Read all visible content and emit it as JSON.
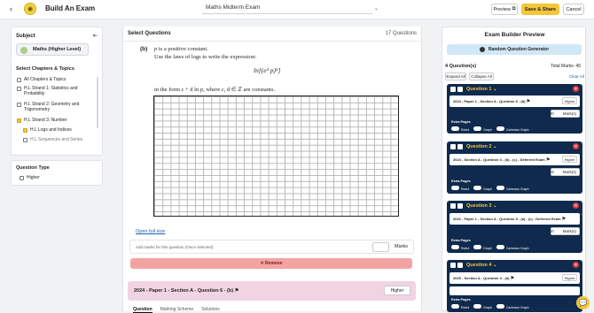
{
  "app": {
    "title": "Build An Exam",
    "exam_name": "Maths Midterm Exam"
  },
  "topbar": {
    "preview_label": "Preview",
    "save_label": "Save & Share",
    "cancel_label": "Cancel"
  },
  "left": {
    "subject_heading": "Subject",
    "subject_value": "Maths (Higher Level)",
    "topics_heading": "Select Chapters & Topics",
    "topics": [
      "All Chapters & Topics",
      "H.L Strand 1: Statistics and Probability",
      "H.L Strand 2: Geometry and Trigonometry",
      "H.L Strand 3: Number",
      "H.L Logs and Indices",
      "H.L Sequences and Series"
    ],
    "question_type_heading": "Question Type",
    "question_type_option": "Higher"
  },
  "center": {
    "heading": "Select Questions",
    "count": "17 Questions",
    "part_label": "(b)",
    "line1": "p is a positive constant.",
    "line2": "Use the laws of logs to write the expression:",
    "formula": "ln[(e³ p)⁵]",
    "line3": "in the form  c + d ln p,  where c, d ∈ ℤ are constants.",
    "open_full_size": "Open full size",
    "marks_prompt": "Add marks for this question (Once selected)",
    "marks_label": "Marks",
    "remove_label": "✕  Remove",
    "next_question_title": "2024 - Paper 1 - Section A - Question 6 - (b)",
    "next_question_level": "Higher",
    "tabs": [
      "Question",
      "Marking Scheme",
      "Solutions"
    ]
  },
  "right": {
    "heading": "Exam Builder Preview",
    "random_label": "Random Question Generator",
    "question_count": "4 Question(s)",
    "total_marks": "Total Marks: 45",
    "expand_all": "Expand All",
    "collapse_all": "Collapse All",
    "clear_all": "Clear All",
    "extra_pages": "Extra Pages",
    "ruled": "Ruled",
    "graph": "Graph",
    "cartesian": "Cartesian Graph",
    "marks_word": "Mark(s)",
    "questions": [
      {
        "title": "Question 1",
        "source": "2024 - Paper 1 - Section A - Question 6 - (b)",
        "level": "Higher",
        "marks": "20"
      },
      {
        "title": "Question 2",
        "source": "2024 - Section A - Question 3 - (b) - (c) - Deferred Exam",
        "level": "Higher",
        "marks": "15"
      },
      {
        "title": "Question 3",
        "source": "2022 - Paper 1 - Section A - Question 5 - (a) - (c) - Deferred Exam",
        "level": "Higher",
        "marks": "10"
      },
      {
        "title": "Question 4",
        "source": "2025 - Section A - Question 3 - (b)",
        "level": "Higher",
        "marks": ""
      }
    ]
  },
  "colors": {
    "accent": "#f5c63a",
    "card": "#0f2a4d",
    "remove": "#f4a3a3",
    "next": "#f1d4e2"
  }
}
